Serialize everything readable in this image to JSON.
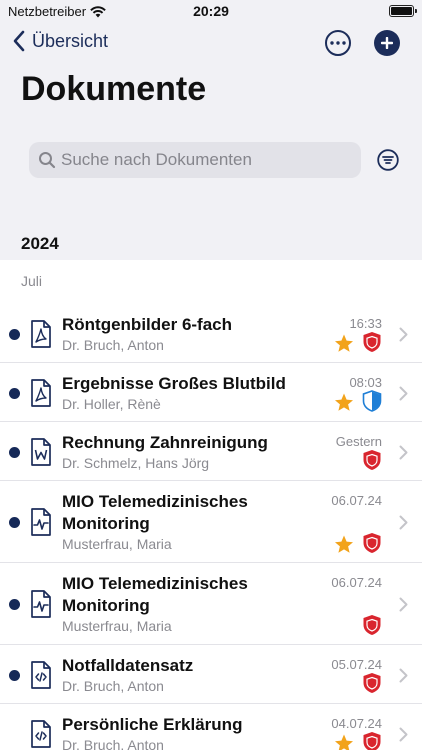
{
  "status_bar": {
    "carrier": "Netzbetreiber",
    "time": "20:29"
  },
  "nav": {
    "back_label": "Übersicht"
  },
  "page": {
    "title": "Dokumente"
  },
  "search": {
    "placeholder": "Suche nach Dokumenten"
  },
  "list": {
    "year": "2024",
    "month": "Juli",
    "documents": [
      {
        "title": "Röntgenbilder 6-fach",
        "subtitle": "Dr. Bruch, Anton",
        "date": "16:33",
        "icon": "pdf-file-icon",
        "starred": true,
        "shield": "red-shield-icon",
        "unread": true
      },
      {
        "title": "Ergebnisse Großes Blutbild",
        "subtitle": "Dr. Holler, Rènè",
        "date": "08:03",
        "icon": "pdf-file-icon",
        "starred": true,
        "shield": "blue-shield-icon",
        "unread": true
      },
      {
        "title": "Rechnung Zahnreinigung",
        "subtitle": "Dr. Schmelz, Hans Jörg",
        "date": "Gestern",
        "icon": "word-file-icon",
        "starred": false,
        "shield": "red-shield-icon",
        "unread": true
      },
      {
        "title": "MIO Telemedizinisches Monitoring",
        "subtitle": "Musterfrau, Maria",
        "date": "06.07.24",
        "icon": "pulse-file-icon",
        "starred": true,
        "shield": "red-shield-icon",
        "unread": true
      },
      {
        "title": "MIO Telemedizinisches Monitoring",
        "subtitle": "Musterfrau, Maria",
        "date": "06.07.24",
        "icon": "pulse-file-icon",
        "starred": false,
        "shield": "red-shield-icon",
        "unread": true
      },
      {
        "title": "Notfalldatensatz",
        "subtitle": "Dr. Bruch, Anton",
        "date": "05.07.24",
        "icon": "code-file-icon",
        "starred": false,
        "shield": "red-shield-icon",
        "unread": true
      },
      {
        "title": "Persönliche Erklärung",
        "subtitle": "Dr. Bruch, Anton",
        "date": "04.07.24",
        "icon": "code-file-icon",
        "starred": true,
        "shield": "red-shield-icon",
        "unread": false
      }
    ]
  },
  "colors": {
    "accent": "#1c2d5a",
    "unread_dot": "#162958",
    "star": "#f2a31b",
    "shield_red": "#d9252e",
    "shield_blue": "#1f7fd6"
  }
}
